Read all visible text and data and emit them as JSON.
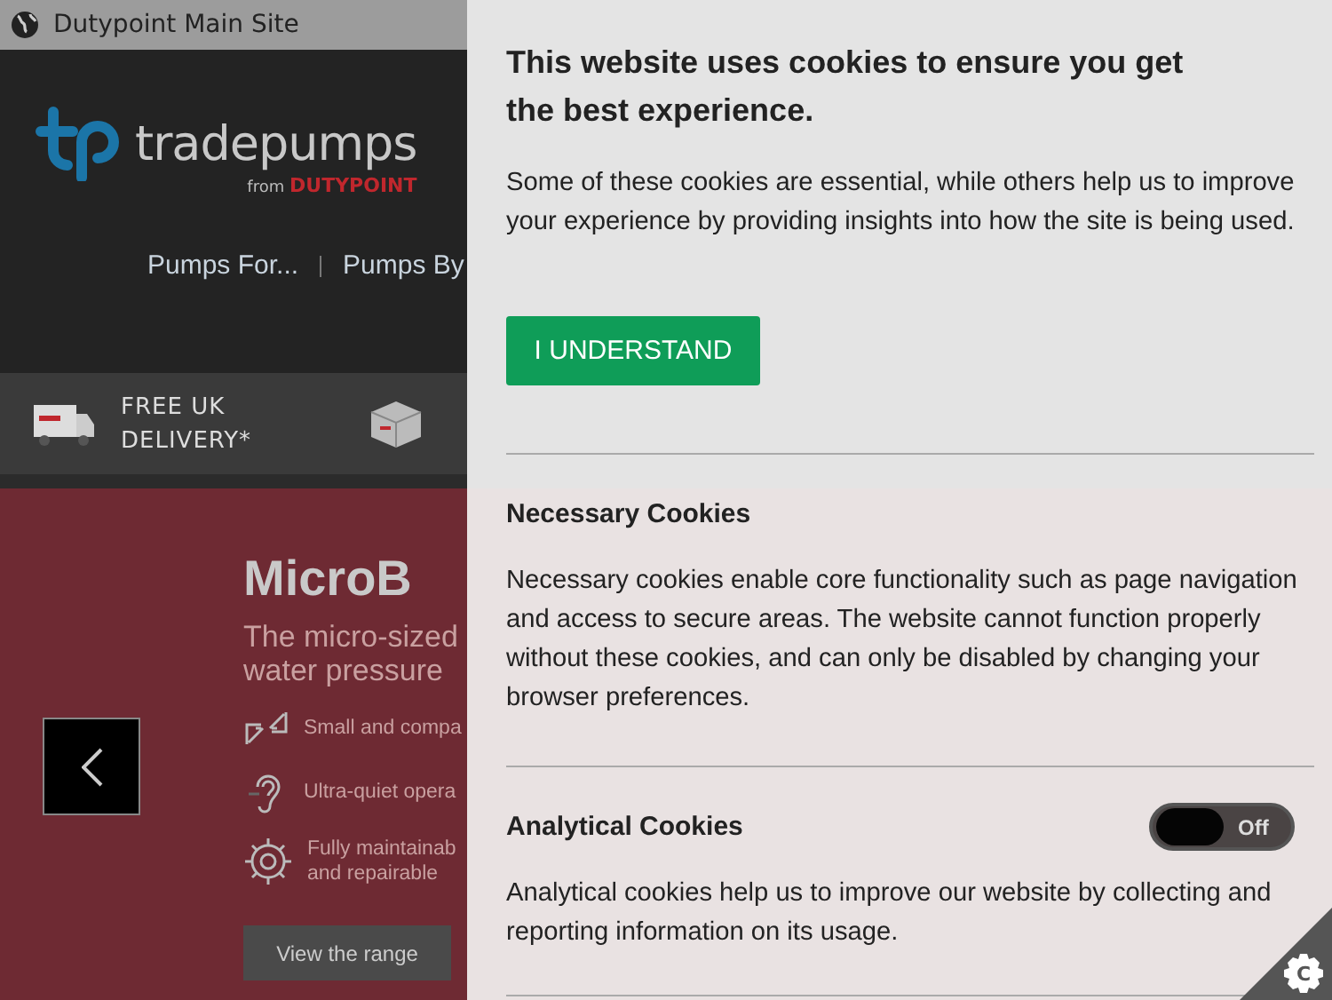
{
  "top_bar": {
    "site_link": "Dutypoint Main Site"
  },
  "header": {
    "logo": {
      "wordmark": "tradepumps",
      "tagline_prefix": "from",
      "tagline_brand": "DUTYPOINT"
    }
  },
  "nav": {
    "row_1": [
      "Pumps For...",
      "Pumps By"
    ]
  },
  "features": [
    {
      "kind": "truck",
      "text": "FREE UK DELIVERY*"
    },
    {
      "kind": "box"
    }
  ],
  "hero": {
    "title": "MicroB",
    "subtitle_lines": [
      "The micro-sized",
      "water pressure"
    ],
    "features": [
      {
        "kind": "compact",
        "text": "Small and compa"
      },
      {
        "kind": "ear",
        "text": "Ultra-quiet opera"
      },
      {
        "kind": "gear",
        "text": "Fully maintainab and repairable"
      }
    ],
    "button": "View the range"
  },
  "cookie_banner": {
    "title": "This website uses cookies to ensure you get the best experience.",
    "intro": "Some of these cookies are essential, while others help us to improve your experience by providing insights into how the site is being used.",
    "accept_button": "I UNDERSTAND",
    "sections": [
      {
        "title": "Necessary Cookies",
        "description": "Necessary cookies enable core functionality such as page navigation and access to secure areas. The website cannot function properly without these cookies, and can only be disabled by changing your browser preferences."
      },
      {
        "title": "Analytical Cookies",
        "description": "Analytical cookies help us to improve our website by collecting and reporting information on its usage.",
        "toggle": {
          "on": false,
          "label": "Off"
        }
      }
    ],
    "settings_badge": "C"
  }
}
